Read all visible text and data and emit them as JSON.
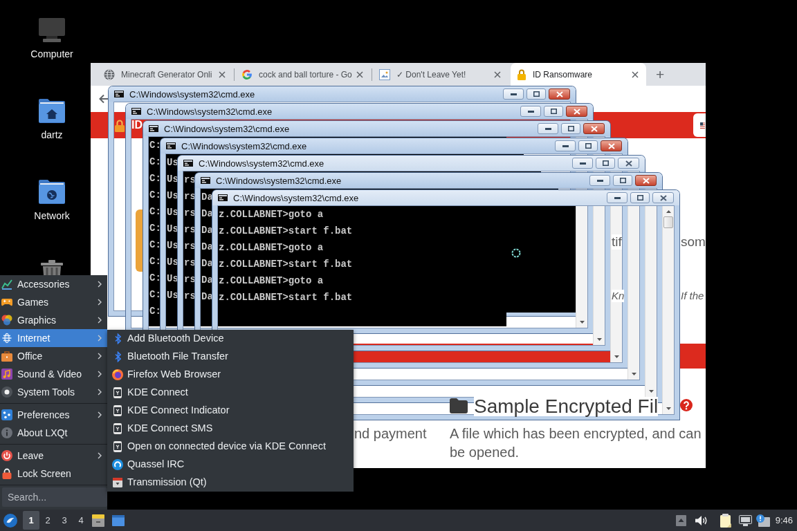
{
  "desktop_icons": [
    {
      "kind": "computer",
      "label": "Computer",
      "selected": false
    },
    {
      "kind": "home",
      "label": "dartz",
      "selected": false
    },
    {
      "kind": "network",
      "label": "Network",
      "selected": false
    },
    {
      "kind": "trash",
      "selected": false
    }
  ],
  "browser": {
    "tabs": [
      {
        "kind": "globe",
        "title": "Minecraft Generator Onli",
        "selected": false
      },
      {
        "kind": "g_logo",
        "title": "cock and ball torture - Go",
        "selected": false
      },
      {
        "kind": "image",
        "title": "✓ Don't Leave Yet!",
        "selected": false
      },
      {
        "kind": "lock",
        "title": "ID Ransomware",
        "selected": true
      }
    ],
    "new_tab": "+",
    "page": {
      "header_title": "ID",
      "line_1": [
        "tif",
        "som"
      ],
      "line_2": [
        "Kn",
        "If the"
      ],
      "sample_heading": "Sample Encrypted Fil",
      "left_text": "nd payment",
      "sample_text": "A file which has been encrypted, and can\nbe opened."
    }
  },
  "cmd_windows": [
    {
      "title": "C:\\Windows\\system32\\cmd.exe",
      "active": true
    },
    {
      "title": "C:\\Windows\\system32\\cmd.exe",
      "active": true
    },
    {
      "title": "C:\\Windows\\system32\\cmd.exe",
      "active": true,
      "lines": [
        "C:",
        "C:",
        "C:",
        "C:",
        "C:",
        "C:",
        "C:",
        "C:",
        "C:",
        "C:",
        "C:"
      ]
    },
    {
      "title": "C:\\Windows\\system32\\cmd.exe",
      "active": true,
      "lines": [
        "Us",
        "Us",
        "Us",
        "Us",
        "Us",
        "Us",
        "Us",
        "Us",
        "Us"
      ]
    },
    {
      "title": "C:\\Windows\\system32\\cmd.exe",
      "active": false,
      "lines": [
        "rs",
        "rs",
        "rs",
        "rs",
        "rs",
        "rs",
        "rs",
        "rs"
      ]
    },
    {
      "title": "C:\\Windows\\system32\\cmd.exe",
      "active": true,
      "lines": [
        "Da",
        "Da",
        "Da",
        "Da",
        "Da",
        "Da",
        "Da"
      ]
    },
    {
      "title": "C:\\Windows\\system32\\cmd.exe",
      "active": false,
      "lines": [
        "z.COLLABNET>goto a",
        "z.COLLABNET>start f.bat",
        "z.COLLABNET>goto a",
        "z.COLLABNET>start f.bat",
        "z.COLLABNET>goto a",
        "z.COLLABNET>start f.bat"
      ]
    }
  ],
  "start_menu": {
    "groups": [
      {
        "items": [
          {
            "kind": "accessories",
            "label": "Accessories",
            "submenu": true,
            "selected": false
          },
          {
            "kind": "games",
            "label": "Games",
            "submenu": true,
            "selected": false
          },
          {
            "kind": "graphics",
            "label": "Graphics",
            "submenu": true,
            "selected": false
          },
          {
            "kind": "internet",
            "label": "Internet",
            "submenu": true,
            "selected": true
          },
          {
            "kind": "office",
            "label": "Office",
            "submenu": true,
            "selected": false
          },
          {
            "kind": "sound",
            "label": "Sound & Video",
            "submenu": true,
            "selected": false
          },
          {
            "kind": "system",
            "label": "System Tools",
            "submenu": true,
            "selected": false
          }
        ]
      },
      {
        "items": [
          {
            "kind": "preferences",
            "label": "Preferences",
            "submenu": true,
            "selected": false
          },
          {
            "kind": "about",
            "label": "About LXQt",
            "submenu": false,
            "selected": false
          }
        ]
      },
      {
        "items": [
          {
            "kind": "leave",
            "label": "Leave",
            "submenu": true,
            "selected": false
          },
          {
            "kind": "lock",
            "label": "Lock Screen",
            "submenu": false,
            "selected": false
          }
        ]
      }
    ],
    "search": {
      "placeholder": "Search..."
    }
  },
  "internet_submenu": {
    "items": [
      {
        "kind": "bluetooth",
        "label": "Add Bluetooth Device",
        "selected": false
      },
      {
        "kind": "bluetooth",
        "label": "Bluetooth File Transfer",
        "selected": false
      },
      {
        "kind": "firefox",
        "label": "Firefox Web Browser",
        "selected": false
      },
      {
        "kind": "kde",
        "label": "KDE Connect",
        "selected": false
      },
      {
        "kind": "kde",
        "label": "KDE Connect Indicator",
        "selected": false
      },
      {
        "kind": "kde",
        "label": "KDE Connect SMS",
        "selected": false
      },
      {
        "kind": "kde",
        "label": "Open on connected device via KDE Connect",
        "selected": false
      },
      {
        "kind": "quassel",
        "label": "Quassel IRC",
        "selected": false
      },
      {
        "kind": "transmission",
        "label": "Transmission (Qt)",
        "selected": false
      }
    ]
  },
  "taskbar": {
    "desktops": [
      {
        "label": "1",
        "selected": true
      },
      {
        "label": "2",
        "selected": false
      },
      {
        "label": "3",
        "selected": false
      },
      {
        "label": "4",
        "selected": false
      }
    ],
    "clock": "9:46"
  }
}
